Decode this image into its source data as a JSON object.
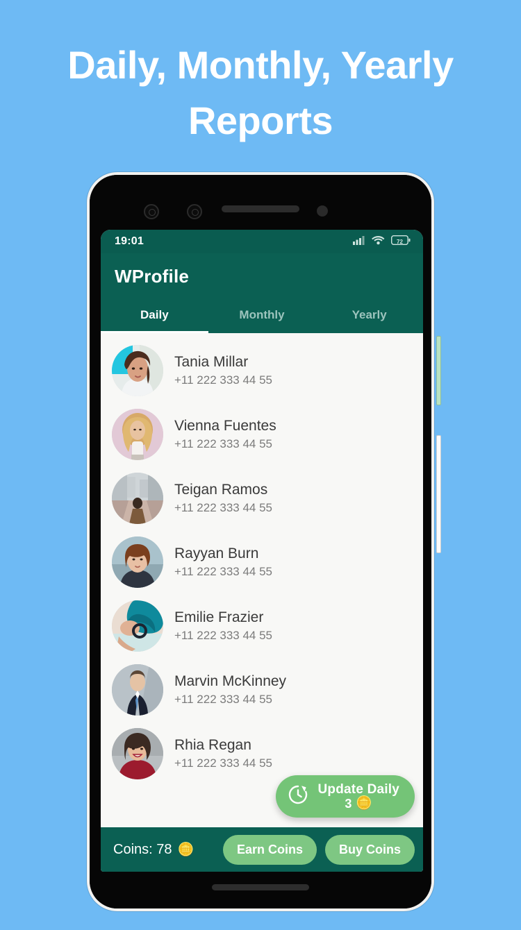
{
  "promo": {
    "headline": "Daily, Monthly, Yearly Reports"
  },
  "colors": {
    "page_background": "#6EBAF4",
    "header_green": "#0B6053",
    "status_green": "#0A5C50",
    "accent_green": "#74C477",
    "pill_green": "#7EC783",
    "list_background": "#F8F8F6",
    "name_text": "#3A3A3A",
    "phone_text": "#7B7B7B"
  },
  "status_bar": {
    "time": "19:01",
    "signal_icon": "cellular-signal-icon",
    "wifi_icon": "wifi-icon",
    "battery_icon": "battery-icon",
    "battery_level": "72"
  },
  "app": {
    "title": "WProfile",
    "tabs": [
      {
        "label": "Daily",
        "active": true
      },
      {
        "label": "Monthly",
        "active": false
      },
      {
        "label": "Yearly",
        "active": false
      }
    ]
  },
  "contacts": [
    {
      "name": "Tania Millar",
      "phone": "+11 222 333 44 55"
    },
    {
      "name": "Vienna Fuentes",
      "phone": "+11 222 333 44 55"
    },
    {
      "name": "Teigan Ramos",
      "phone": "+11 222 333 44 55"
    },
    {
      "name": "Rayyan Burn",
      "phone": "+11 222 333 44 55"
    },
    {
      "name": "Emilie Frazier",
      "phone": "+11 222 333 44 55"
    },
    {
      "name": "Marvin McKinney",
      "phone": "+11 222 333 44 55"
    },
    {
      "name": "Rhia Regan",
      "phone": "+11 222 333 44 55"
    }
  ],
  "fab": {
    "icon": "update-clock-icon",
    "title": "Update Daily",
    "cost": "3",
    "coin_glyph": "🪙"
  },
  "coin_bar": {
    "label": "Coins: 78",
    "coin_glyph": "🪙",
    "earn_button": "Earn Coins",
    "buy_button": "Buy Coins"
  }
}
